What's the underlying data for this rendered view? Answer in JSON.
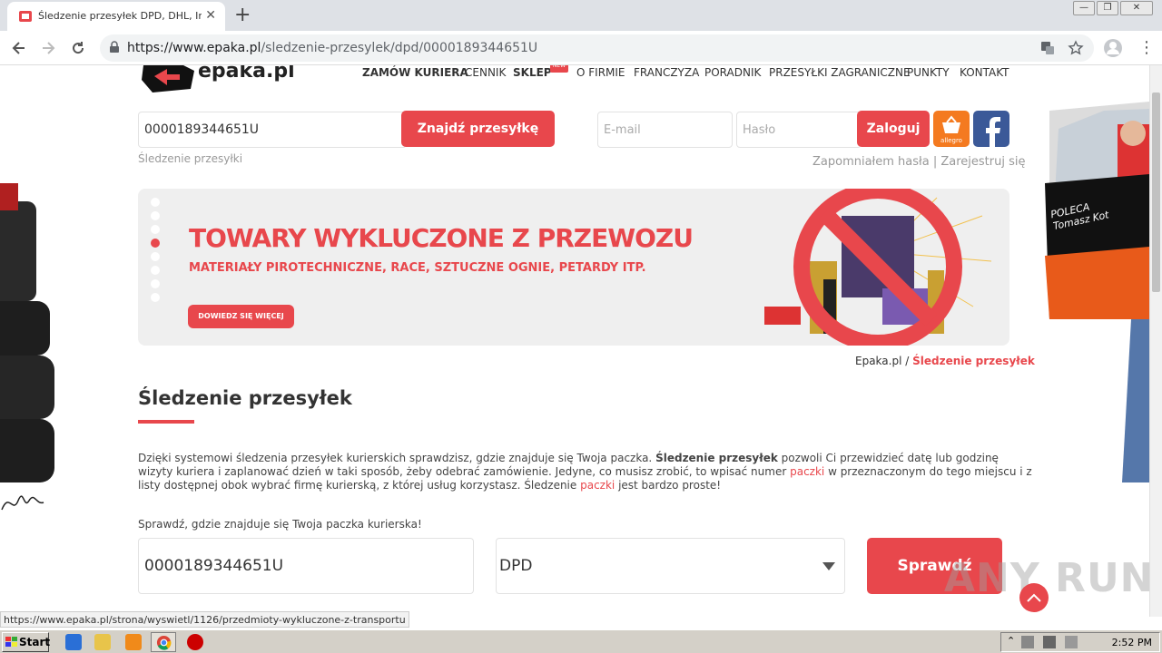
{
  "browser": {
    "tab_title": "Śledzenie przesyłek DPD, DHL, InPost",
    "tab_close": "✕",
    "new_tab": "+",
    "url_host": "https://www.epaka.pl",
    "url_path": "/sledzenie-przesylek/dpd/0000189344651U",
    "win_min": "—",
    "win_max": "❐",
    "win_close": "✕"
  },
  "site": {
    "logo_text": "epaka.pl",
    "nav": [
      "ZAMÓW KURIERA",
      "CENNIK",
      "SKLEP",
      "O FIRMIE",
      "FRANCZYZA",
      "PORADNIK",
      "PRZESYŁKI ZAGRANICZNE",
      "PUNKTY",
      "KONTAKT"
    ],
    "nav_badge": "NEW",
    "tracking_input": "0000189344651U",
    "find_button": "Znajdź przesyłkę",
    "tracking_hint": "Śledzenie przesyłki",
    "email_placeholder": "E-mail",
    "password_placeholder": "Hasło",
    "login_button": "Zaloguj",
    "allegro_label": "allegro",
    "forgot_link": "Zapomniałem hasła",
    "separator": "|",
    "register_link": "Zarejestruj się"
  },
  "banner": {
    "title": "TOWARY WYKLUCZONE Z PRZEWOZU",
    "subtitle": "MATERIAŁY PIROTECHNICZNE, RACE, SZTUCZNE OGNIE, PETARDY ITP.",
    "button": "DOWIEDZ SIĘ WIĘCEJ",
    "dots_count": 8,
    "active_dot": 3
  },
  "breadcrumb": {
    "home": "Epaka.pl",
    "sep": " / ",
    "current": "Śledzenie przesyłek"
  },
  "content": {
    "heading": "Śledzenie przesyłek",
    "p1_a": "Dzięki systemowi śledzenia przesyłek kurierskich sprawdzisz, gdzie znajduje się Twoja paczka. ",
    "p1_b": "Śledzenie przesyłek",
    "p1_c": " pozwoli Ci przewidzieć datę lub godzinę",
    "p2": "wizyty kuriera i zaplanować dzień w taki sposób, żeby odebrać zamówienie. Jedyne, co musisz zrobić, to wpisać numer ",
    "p2_link": "paczki",
    "p2_end": " w przeznaczonym do tego miejscu i z",
    "p3": "listy dostępnej obok wybrać firmę kurierską, z której usług korzystasz. Śledzenie ",
    "p3_link": "paczki",
    "p3_end": " jest bardzo proste!",
    "check_label": "Sprawdź, gdzie znajduje się Twoja paczka kurierska!",
    "check_input": "0000189344651U",
    "carrier": "DPD",
    "check_button": "Sprawdź"
  },
  "door_text": "POLECA Tomasz Kot",
  "status_url": "https://www.epaka.pl/strona/wyswietl/1126/przedmioty-wykluczone-z-transportu",
  "taskbar": {
    "start": "Start",
    "clock": "2:52 PM"
  },
  "watermark": "ANY RUN",
  "colors": {
    "accent": "#e8474c",
    "banner_bg": "#efefef",
    "taskbar": "#d4d0c8"
  }
}
